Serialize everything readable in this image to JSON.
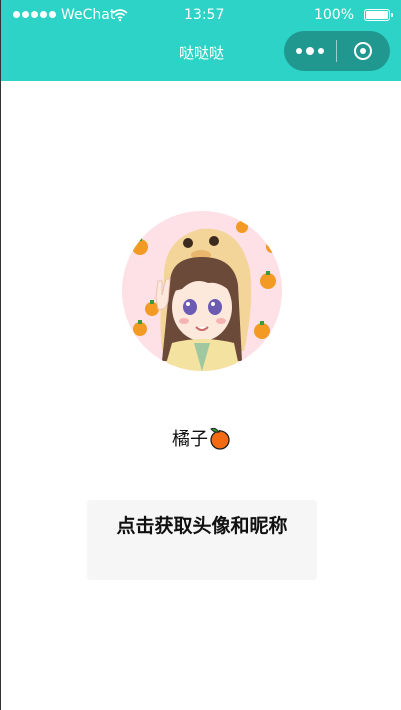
{
  "status_bar": {
    "carrier": "WeChat",
    "time": "13:57",
    "battery": "100%"
  },
  "nav": {
    "title": "哒哒哒"
  },
  "profile": {
    "nickname": "橘子"
  },
  "actions": {
    "get_profile_label": "点击获取头像和昵称"
  },
  "colors": {
    "header": "#2dd3c6",
    "button_bg": "#f6f6f6"
  },
  "icons": [
    "wifi-icon",
    "battery-icon",
    "more-dots-icon",
    "close-circle-icon",
    "orange-emoji-icon"
  ]
}
